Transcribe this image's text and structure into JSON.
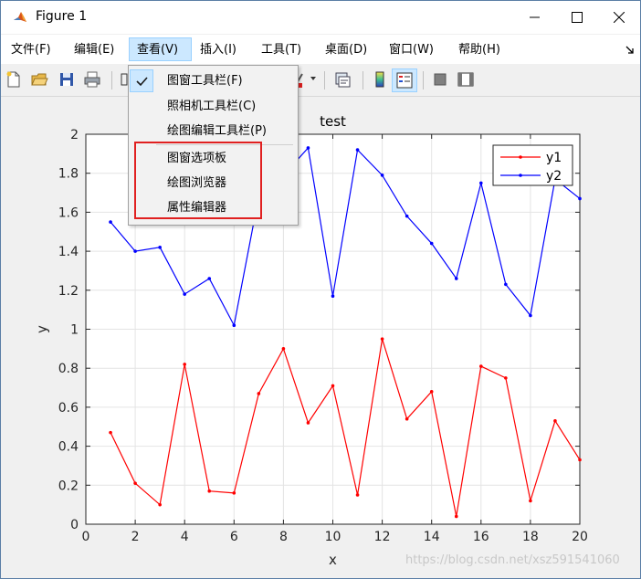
{
  "window": {
    "title": "Figure 1"
  },
  "menubar": {
    "items": [
      "文件(F)",
      "编辑(E)",
      "查看(V)",
      "插入(I)",
      "工具(T)",
      "桌面(D)",
      "窗口(W)",
      "帮助(H)"
    ],
    "active_index": 2
  },
  "view_menu": {
    "items": [
      {
        "label": "图窗工具栏(F)",
        "checked": true
      },
      {
        "label": "照相机工具栏(C)",
        "checked": false
      },
      {
        "label": "绘图编辑工具栏(P)",
        "checked": false
      },
      {
        "label": "图窗选项板",
        "checked": false
      },
      {
        "label": "绘图浏览器",
        "checked": false
      },
      {
        "label": "属性编辑器",
        "checked": false
      }
    ]
  },
  "chart_data": {
    "type": "line",
    "title": "test",
    "xlabel": "x",
    "ylabel": "y",
    "xlim": [
      0,
      20
    ],
    "ylim": [
      0,
      2
    ],
    "xticks": [
      0,
      2,
      4,
      6,
      8,
      10,
      12,
      14,
      16,
      18,
      20
    ],
    "yticks": [
      0,
      0.2,
      0.4,
      0.6,
      0.8,
      1,
      1.2,
      1.4,
      1.6,
      1.8,
      2
    ],
    "ytick_labels": [
      "0",
      "0.2",
      "0.4",
      "0.6",
      "0.8",
      "1",
      "1.2",
      "1.4",
      "1.6",
      "1.8",
      "2"
    ],
    "grid": true,
    "legend_position": "top-right",
    "x": [
      1,
      2,
      3,
      4,
      5,
      6,
      7,
      8,
      9,
      10,
      11,
      12,
      13,
      14,
      15,
      16,
      17,
      18,
      19,
      20
    ],
    "series": [
      {
        "name": "y1",
        "color": "#ff0000",
        "values": [
          0.47,
          0.21,
          0.1,
          0.82,
          0.17,
          0.16,
          0.67,
          0.9,
          0.52,
          0.71,
          0.15,
          0.95,
          0.54,
          0.68,
          0.04,
          0.81,
          0.75,
          0.12,
          0.53,
          0.33
        ]
      },
      {
        "name": "y2",
        "color": "#0000ff",
        "values": [
          1.55,
          1.4,
          1.42,
          1.18,
          1.26,
          1.02,
          1.68,
          1.79,
          1.93,
          1.17,
          1.92,
          1.79,
          1.58,
          1.44,
          1.26,
          1.75,
          1.23,
          1.07,
          1.77,
          1.67
        ]
      }
    ]
  },
  "watermark": "https://blog.csdn.net/xsz591541060",
  "colors": {
    "highlight_box": "#e02020",
    "menu_active": "#cce8ff"
  }
}
